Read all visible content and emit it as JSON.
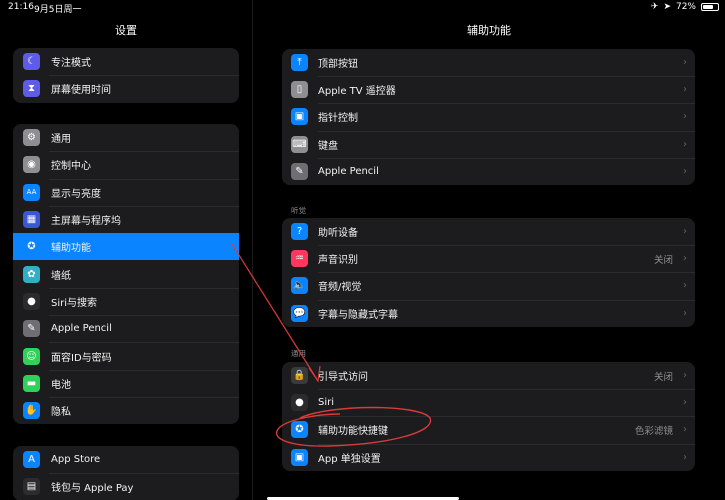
{
  "status": {
    "time": "21:16",
    "date": "9月5日周一",
    "battery": "72%",
    "battery_level": 0.72
  },
  "left": {
    "title": "设置",
    "group1": [
      {
        "label": "专注模式",
        "icon": "moon-icon",
        "color": "#5e5ce6",
        "glyph": "☾"
      },
      {
        "label": "屏幕使用时间",
        "icon": "hourglass-icon",
        "color": "#5e5ce6",
        "glyph": "⧗"
      }
    ],
    "group2": [
      {
        "label": "通用",
        "icon": "gear-icon",
        "color": "#8e8e93",
        "glyph": "⚙"
      },
      {
        "label": "控制中心",
        "icon": "toggles-icon",
        "color": "#8e8e93",
        "glyph": "◉"
      },
      {
        "label": "显示与亮度",
        "icon": "text-size-icon",
        "color": "#0a84ff",
        "glyph": "AA"
      },
      {
        "label": "主屏幕与程序坞",
        "icon": "home-grid-icon",
        "color": "#3a57d6",
        "glyph": "▦"
      },
      {
        "label": "辅助功能",
        "icon": "accessibility-icon",
        "color": "#0a84ff",
        "glyph": "✪"
      },
      {
        "label": "墙纸",
        "icon": "flower-icon",
        "color": "#30b0c7",
        "glyph": "✿"
      },
      {
        "label": "Siri与搜索",
        "icon": "siri-icon",
        "color": "#2b2b2e",
        "glyph": "●"
      },
      {
        "label": "Apple Pencil",
        "icon": "pencil-icon",
        "color": "#6e6e73",
        "glyph": "✎"
      },
      {
        "label": "面容ID与密码",
        "icon": "face-id-icon",
        "color": "#30d158",
        "glyph": "☺"
      },
      {
        "label": "电池",
        "icon": "battery-icon",
        "color": "#30d158",
        "glyph": "▬"
      },
      {
        "label": "隐私",
        "icon": "hand-icon",
        "color": "#0a84ff",
        "glyph": "✋"
      }
    ],
    "group3": [
      {
        "label": "App Store",
        "icon": "app-store-icon",
        "color": "#0a84ff",
        "glyph": "A"
      },
      {
        "label": "钱包与 Apple Pay",
        "icon": "wallet-icon",
        "color": "#2c2c2e",
        "glyph": "▤"
      }
    ]
  },
  "right": {
    "title": "辅助功能",
    "group1": [
      {
        "label": "顶部按钮",
        "icon": "top-button-icon",
        "color": "#0a84ff",
        "glyph": "⤒"
      },
      {
        "label": "Apple TV 遥控器",
        "icon": "remote-icon",
        "color": "#8e8e93",
        "glyph": "▯"
      },
      {
        "label": "指针控制",
        "icon": "pointer-icon",
        "color": "#0a84ff",
        "glyph": "▣"
      },
      {
        "label": "键盘",
        "icon": "keyboard-icon",
        "color": "#8e8e93",
        "glyph": "⌨"
      },
      {
        "label": "Apple Pencil",
        "icon": "pencil-icon",
        "color": "#6e6e73",
        "glyph": "✎"
      }
    ],
    "section_hearing": "听觉",
    "group2": [
      {
        "label": "助听设备",
        "icon": "ear-icon",
        "color": "#0a84ff",
        "glyph": "?"
      },
      {
        "label": "声音识别",
        "icon": "waveform-icon",
        "color": "#ff375f",
        "glyph": "♒",
        "value": "关闭"
      },
      {
        "label": "音频/视觉",
        "icon": "speaker-icon",
        "color": "#0a84ff",
        "glyph": "🔈"
      },
      {
        "label": "字幕与隐藏式字幕",
        "icon": "captions-icon",
        "color": "#0a84ff",
        "glyph": "💬"
      }
    ],
    "section_general": "通用",
    "group3": [
      {
        "label": "引导式访问",
        "icon": "lock-icon",
        "color": "#3a3a3c",
        "glyph": "🔒",
        "value": "关闭"
      },
      {
        "label": "Siri",
        "icon": "siri-icon",
        "color": "#2b2b2e",
        "glyph": "●"
      },
      {
        "label": "辅助功能快捷键",
        "icon": "accessibility-icon",
        "color": "#0a84ff",
        "glyph": "✪",
        "value": "色彩滤镜"
      },
      {
        "label": "App 单独设置",
        "icon": "app-settings-icon",
        "color": "#0a84ff",
        "glyph": "▣"
      }
    ]
  },
  "annotation_color": "#d93a3a"
}
